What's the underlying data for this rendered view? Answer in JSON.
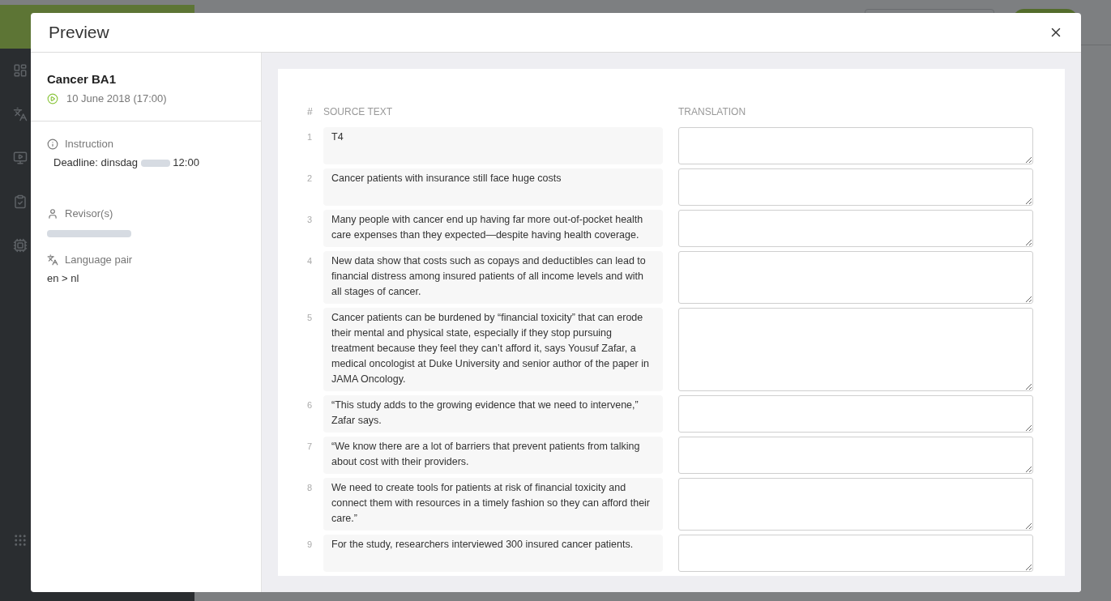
{
  "modal": {
    "title": "Preview"
  },
  "details": {
    "project": "Cancer BA1",
    "date": "10 June 2018 (17:00)",
    "instruction": {
      "heading": "Instruction",
      "before": "Deadline: dinsdag",
      "redacted": true,
      "after": "12:00"
    },
    "revisors": {
      "heading": "Revisor(s)",
      "redacted": true
    },
    "language_pair": {
      "heading": "Language pair",
      "value": "en > nl"
    }
  },
  "table": {
    "columns": [
      "#",
      "SOURCE TEXT",
      "TRANSLATION"
    ],
    "rows": [
      {
        "number": "1",
        "source": "T4"
      },
      {
        "number": "2",
        "source": "Cancer patients with insurance still face huge costs"
      },
      {
        "number": "3",
        "source": "Many people with cancer end up having far more out-of-pocket health care expenses than they expected—despite having health coverage."
      },
      {
        "number": "4",
        "source": "New data show that costs such as copays and deductibles can lead to financial distress among insured patients of all income levels and with all stages of cancer."
      },
      {
        "number": "5",
        "source": "Cancer patients can be burdened by “financial toxicity” that can erode their mental and physical state, especially if they stop pursuing treatment because they feel they can’t afford it, says Yousuf Zafar, a medical oncologist at Duke University and senior author of the paper in JAMA Oncology."
      },
      {
        "number": "6",
        "source": "“This study adds to the growing evidence that we need to intervene,” Zafar says."
      },
      {
        "number": "7",
        "source": "“We know there are a lot of barriers that prevent patients from talking about cost with their providers."
      },
      {
        "number": "8",
        "source": "We need to create tools for patients at risk of financial toxicity and connect them with resources in a timely fashion so they can afford their care.”"
      },
      {
        "number": "9",
        "source": "For the study, researchers interviewed 300 insured cancer patients."
      }
    ]
  }
}
